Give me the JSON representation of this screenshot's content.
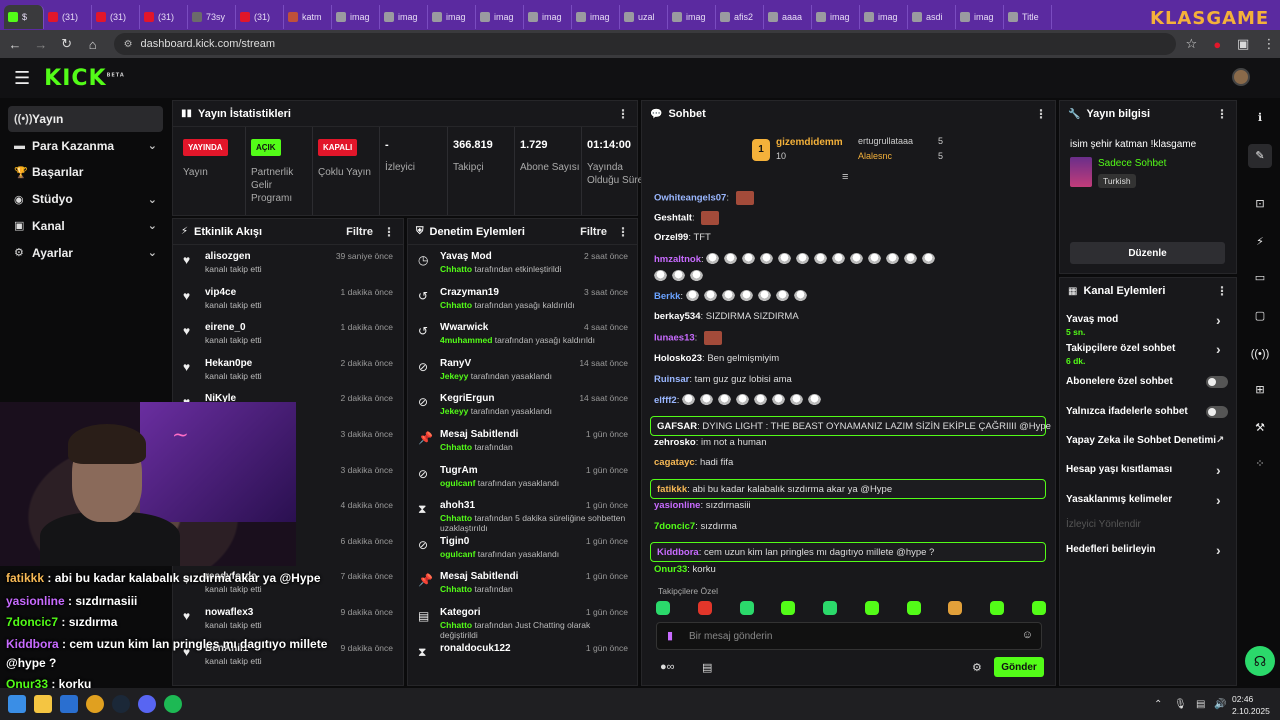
{
  "browser": {
    "tabs": [
      "$",
      "(31)",
      "(31)",
      "(31)",
      "73sy",
      "(31)",
      "katm",
      "imag",
      "imag",
      "imag",
      "imag",
      "imag",
      "imag",
      "uzal",
      "imag",
      "afis2",
      "aaaa",
      "imag",
      "imag",
      "asdi",
      "imag",
      "Title"
    ],
    "url": "dashboard.kick.com/stream",
    "watermark": "KLASGAME"
  },
  "app": {
    "logo": "KICK",
    "logo_sup": "BETA"
  },
  "sidebar": {
    "items": [
      {
        "label": "Yayın",
        "icon": "broadcast-icon",
        "active": true
      },
      {
        "label": "Para Kazanma",
        "icon": "money-icon",
        "expand": true
      },
      {
        "label": "Başarılar",
        "icon": "trophy-icon"
      },
      {
        "label": "Stüdyo",
        "icon": "studio-icon",
        "expand": true
      },
      {
        "label": "Kanal",
        "icon": "channel-icon",
        "expand": true
      },
      {
        "label": "Ayarlar",
        "icon": "settings-icon",
        "expand": true
      }
    ]
  },
  "stats": {
    "title": "Yayın İstatistikleri",
    "items": [
      {
        "badge": "YAYINDA",
        "label": "Yayın",
        "color": "#e2162a"
      },
      {
        "badge": "AÇIK",
        "label": "Partnerlik Gelir Programı",
        "color": "#53fc18"
      },
      {
        "badge": "KAPALI",
        "label": "Çoklu Yayın",
        "color": "#e2162a"
      },
      {
        "value": "-",
        "label": "İzleyici"
      },
      {
        "value": "366.819",
        "label": "Takipçi"
      },
      {
        "value": "1.729",
        "label": "Abone Sayısı"
      },
      {
        "value": "01:14:00",
        "label": "Yayında Olduğu Süre"
      }
    ]
  },
  "activity": {
    "title": "Etkinlik Akışı",
    "filter": "Filtre",
    "rows": [
      {
        "name": "alisozgen",
        "desc": "kanalı takip etti",
        "time": "39 saniye önce"
      },
      {
        "name": "vip4ce",
        "desc": "kanalı takip etti",
        "time": "1 dakika önce"
      },
      {
        "name": "eirene_0",
        "desc": "kanalı takip etti",
        "time": "1 dakika önce"
      },
      {
        "name": "Hekan0pe",
        "desc": "kanalı takip etti",
        "time": "2 dakika önce"
      },
      {
        "name": "NiKyle",
        "desc": "",
        "time": "2 dakika önce"
      },
      {
        "name": "",
        "desc": "",
        "time": "3 dakika önce"
      },
      {
        "name": "",
        "desc": "",
        "time": "3 dakika önce"
      },
      {
        "name": "ne oldu!",
        "desc": "",
        "time": "4 dakika önce"
      },
      {
        "name": "",
        "desc": "",
        "time": "6 dakika önce"
      },
      {
        "name": "readyforde",
        "desc": "kanalı takip etti",
        "time": "7 dakika önce"
      },
      {
        "name": "nowaflex3",
        "desc": "kanalı takip etti",
        "time": "9 dakika önce"
      },
      {
        "name": "BenAnil1",
        "desc": "kanalı takip etti",
        "time": "9 dakika önce"
      }
    ]
  },
  "moderation": {
    "title": "Denetim Eylemleri",
    "filter": "Filtre",
    "rows": [
      {
        "icon": "slow-mode-icon",
        "title": "Yavaş Mod",
        "who": "Chhatto",
        "desc": " tarafından etkinleştirildi",
        "time": "2 saat önce"
      },
      {
        "icon": "undo-icon",
        "title": "Crazyman19",
        "who": "Chhatto",
        "desc": " tarafından yasağı kaldırıldı",
        "time": "3 saat önce"
      },
      {
        "icon": "undo-icon",
        "title": "Wwarwick",
        "who": "4muhammed",
        "desc": " tarafından yasağı kaldırıldı",
        "time": "4 saat önce"
      },
      {
        "icon": "ban-icon",
        "title": "RanyV",
        "who": "Jekeyy",
        "desc": " tarafından yasaklandı",
        "time": "14 saat önce"
      },
      {
        "icon": "ban-icon",
        "title": "KegriErgun",
        "who": "Jekeyy",
        "desc": " tarafından yasaklandı",
        "time": "14 saat önce"
      },
      {
        "icon": "pin-icon",
        "title": "Mesaj Sabitlendi",
        "who": "Chhatto",
        "desc": " tarafından",
        "time": "1 gün önce"
      },
      {
        "icon": "ban-icon",
        "title": "TugrAm",
        "who": "ogulcanf",
        "desc": " tarafından yasaklandı",
        "time": "1 gün önce"
      },
      {
        "icon": "hourglass-icon",
        "title": "ahoh31",
        "who": "Chhatto",
        "desc": " tarafından 5 dakika süreliğine sohbetten uzaklaştırıldı",
        "time": "1 gün önce"
      },
      {
        "icon": "ban-icon",
        "title": "Tigin0",
        "who": "ogulcanf",
        "desc": " tarafından yasaklandı",
        "time": "1 gün önce"
      },
      {
        "icon": "pin-icon",
        "title": "Mesaj Sabitlendi",
        "who": "Chhatto",
        "desc": " tarafından",
        "time": "1 gün önce"
      },
      {
        "icon": "category-icon",
        "title": "Kategori",
        "who": "Chhatto",
        "desc": " tarafından Just Chatting olarak değiştirildi",
        "time": "1 gün önce"
      },
      {
        "icon": "hourglass-icon",
        "title": "ronaldocuk122",
        "who": "",
        "desc": "",
        "time": "1 gün önce"
      }
    ]
  },
  "chat": {
    "title": "Sohbet",
    "top": {
      "rank": "1",
      "name": "gizemdidemm",
      "count": "10",
      "second": "ertugrullataaa",
      "second_count": "5",
      "third": "Alalesnc",
      "third_count": "5"
    },
    "messages": [
      {
        "user": "Owhiteangels07",
        "color": "#9ab7ff",
        "text": "",
        "thumb": true
      },
      {
        "user": "Geshtalt",
        "color": "#ffffff",
        "text": "",
        "thumb": true
      },
      {
        "user": "Orzel99",
        "color": "#ffffff",
        "text": "TFT"
      },
      {
        "user": "hmzaltnok",
        "color": "#c86bff",
        "text": "",
        "emotes": 16
      },
      {
        "user": "Berkk",
        "color": "#6aa2ff",
        "text": "",
        "emotes": 7
      },
      {
        "user": "berkay534",
        "color": "#ffffff",
        "text": "SIZDIRMA SIZDIRMA"
      },
      {
        "user": "lunaes13",
        "color": "#c86bff",
        "text": "",
        "thumb": true
      },
      {
        "user": "Holosko23",
        "color": "#ffffff",
        "text": "Ben gelmişmiyim"
      },
      {
        "user": "Ruinsar",
        "color": "#9ab7ff",
        "text": "tam guz guz lobisi ama"
      },
      {
        "user": "elfff2",
        "color": "#9ab7ff",
        "text": "",
        "emotes": 8
      },
      {
        "user": "GAFSAR",
        "color": "#ffffff",
        "text": "DYING LIGHT : THE BEAST OYNAMANIZ LAZIM SİZİN EKİPLE ÇAĞRIIII @Hype",
        "box": true
      },
      {
        "user": "zehrosko",
        "color": "#ffffff",
        "text": "im not a human"
      },
      {
        "user": "cagatayc",
        "color": "#f7b955",
        "text": "hadi fifa"
      },
      {
        "user": "fatikkk",
        "color": "#f7b955",
        "text": "abi bu kadar kalabalık sızdırma akar ya @Hype",
        "box": true
      },
      {
        "user": "yasionline",
        "color": "#c86bff",
        "text": "sızdırnasiii"
      },
      {
        "user": "7doncic7",
        "color": "#53fc18",
        "text": "sızdırma"
      },
      {
        "user": "Kiddbora",
        "color": "#c86bff",
        "text": "cem uzun kim lan pringles mı dagıtıyo millete @hype ?",
        "box": true
      },
      {
        "user": "Onur33",
        "color": "#53fc18",
        "text": "korku"
      }
    ],
    "followers_only": "Takipçilere Özel",
    "placeholder": "Bir mesaj gönderin",
    "send": "Gönder"
  },
  "stream_info": {
    "title": "Yayın bilgisi",
    "stream_title": "isim şehir katman !klasgame",
    "category": "Sadece Sohbet",
    "tag": "Turkish",
    "edit": "Düzenle"
  },
  "channel_actions": {
    "title": "Kanal Eylemleri",
    "items": [
      {
        "label": "Yavaş mod",
        "sub": "5 sn.",
        "control": "arrow"
      },
      {
        "label": "Takipçilere özel sohbet",
        "sub": "6 dk.",
        "control": "arrow"
      },
      {
        "label": "Abonelere özel sohbet",
        "control": "toggle"
      },
      {
        "label": "Yalnızca ifadelerle sohbet",
        "control": "toggle"
      },
      {
        "label": "Yapay Zeka ile Sohbet Denetimi",
        "control": "external"
      },
      {
        "label": "Hesap yaşı kısıtlaması",
        "control": "arrow"
      },
      {
        "label": "Yasaklanmış kelimeler",
        "control": "arrow"
      },
      {
        "label": "İzleyici Yönlendir",
        "control": "none",
        "disabled": true
      },
      {
        "label": "Hedefleri belirleyin",
        "control": "arrow"
      }
    ]
  },
  "overlay_chat": [
    {
      "user": "fatikkk",
      "color": "#f7b955",
      "text": " : abi bu kadar kalabalık sızdırma akar ya @Hype"
    },
    {
      "user": "yasionline",
      "color": "#c86bff",
      "text": " : sızdırnasiii"
    },
    {
      "user": "7doncic7",
      "color": "#53fc18",
      "text": " : sızdırma"
    },
    {
      "user": "Kiddbora",
      "color": "#c86bff",
      "text": " : cem uzun kim lan pringles mı dagıtıyo millete"
    },
    {
      "user": "",
      "color": "#ffffff",
      "text": "@hype ?"
    },
    {
      "user": "Onur33",
      "color": "#53fc18",
      "text": " : korku"
    }
  ],
  "taskbar": {
    "time": "02:46",
    "date": "2.10.2025"
  },
  "colors": {
    "accent": "#53fc18",
    "live": "#e2162a",
    "panel": "#18181b"
  }
}
